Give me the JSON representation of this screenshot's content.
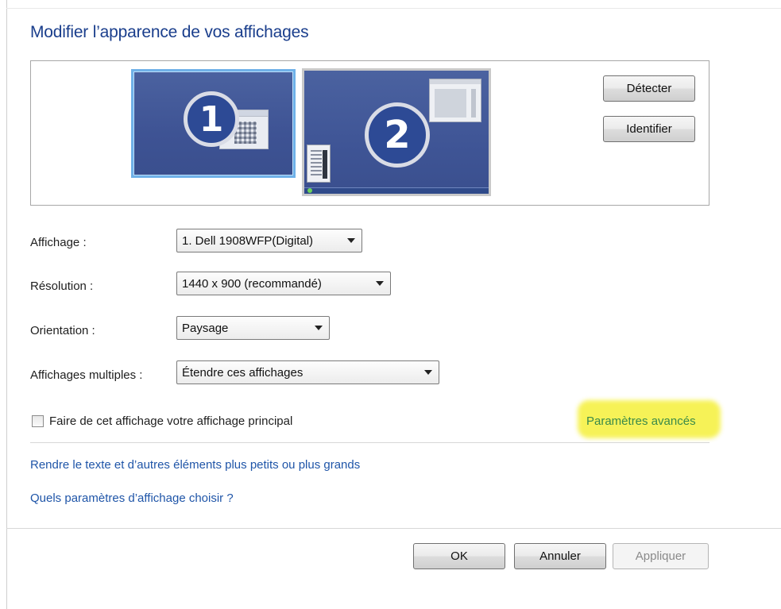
{
  "title": "Modifier l’apparence de vos affichages",
  "preview": {
    "monitor1_number": "1",
    "monitor2_number": "2",
    "detect_label": "Détecter",
    "identify_label": "Identifier"
  },
  "settings": {
    "display_label": "Affichage :",
    "display_value": "1. Dell 1908WFP(Digital)",
    "resolution_label": "Résolution :",
    "resolution_value": "1440 x 900 (recommandé)",
    "orientation_label": "Orientation :",
    "orientation_value": "Paysage",
    "multiple_label": "Affichages multiples :",
    "multiple_value": "Étendre ces affichages"
  },
  "primary_checkbox": {
    "label": "Faire de cet affichage votre affichage principal",
    "checked": false
  },
  "advanced_link": "Paramètres avancés",
  "links": {
    "text_size": "Rendre le texte et d’autres éléments plus petits ou plus grands",
    "which_settings": "Quels paramètres d’affichage choisir ?"
  },
  "footer": {
    "ok_label": "OK",
    "cancel_label": "Annuler",
    "apply_label": "Appliquer"
  },
  "colors": {
    "title": "#1a3e8c",
    "link": "#1f55a8",
    "highlight": "#f5f03a",
    "selected_monitor_border": "#6fb1e8"
  }
}
